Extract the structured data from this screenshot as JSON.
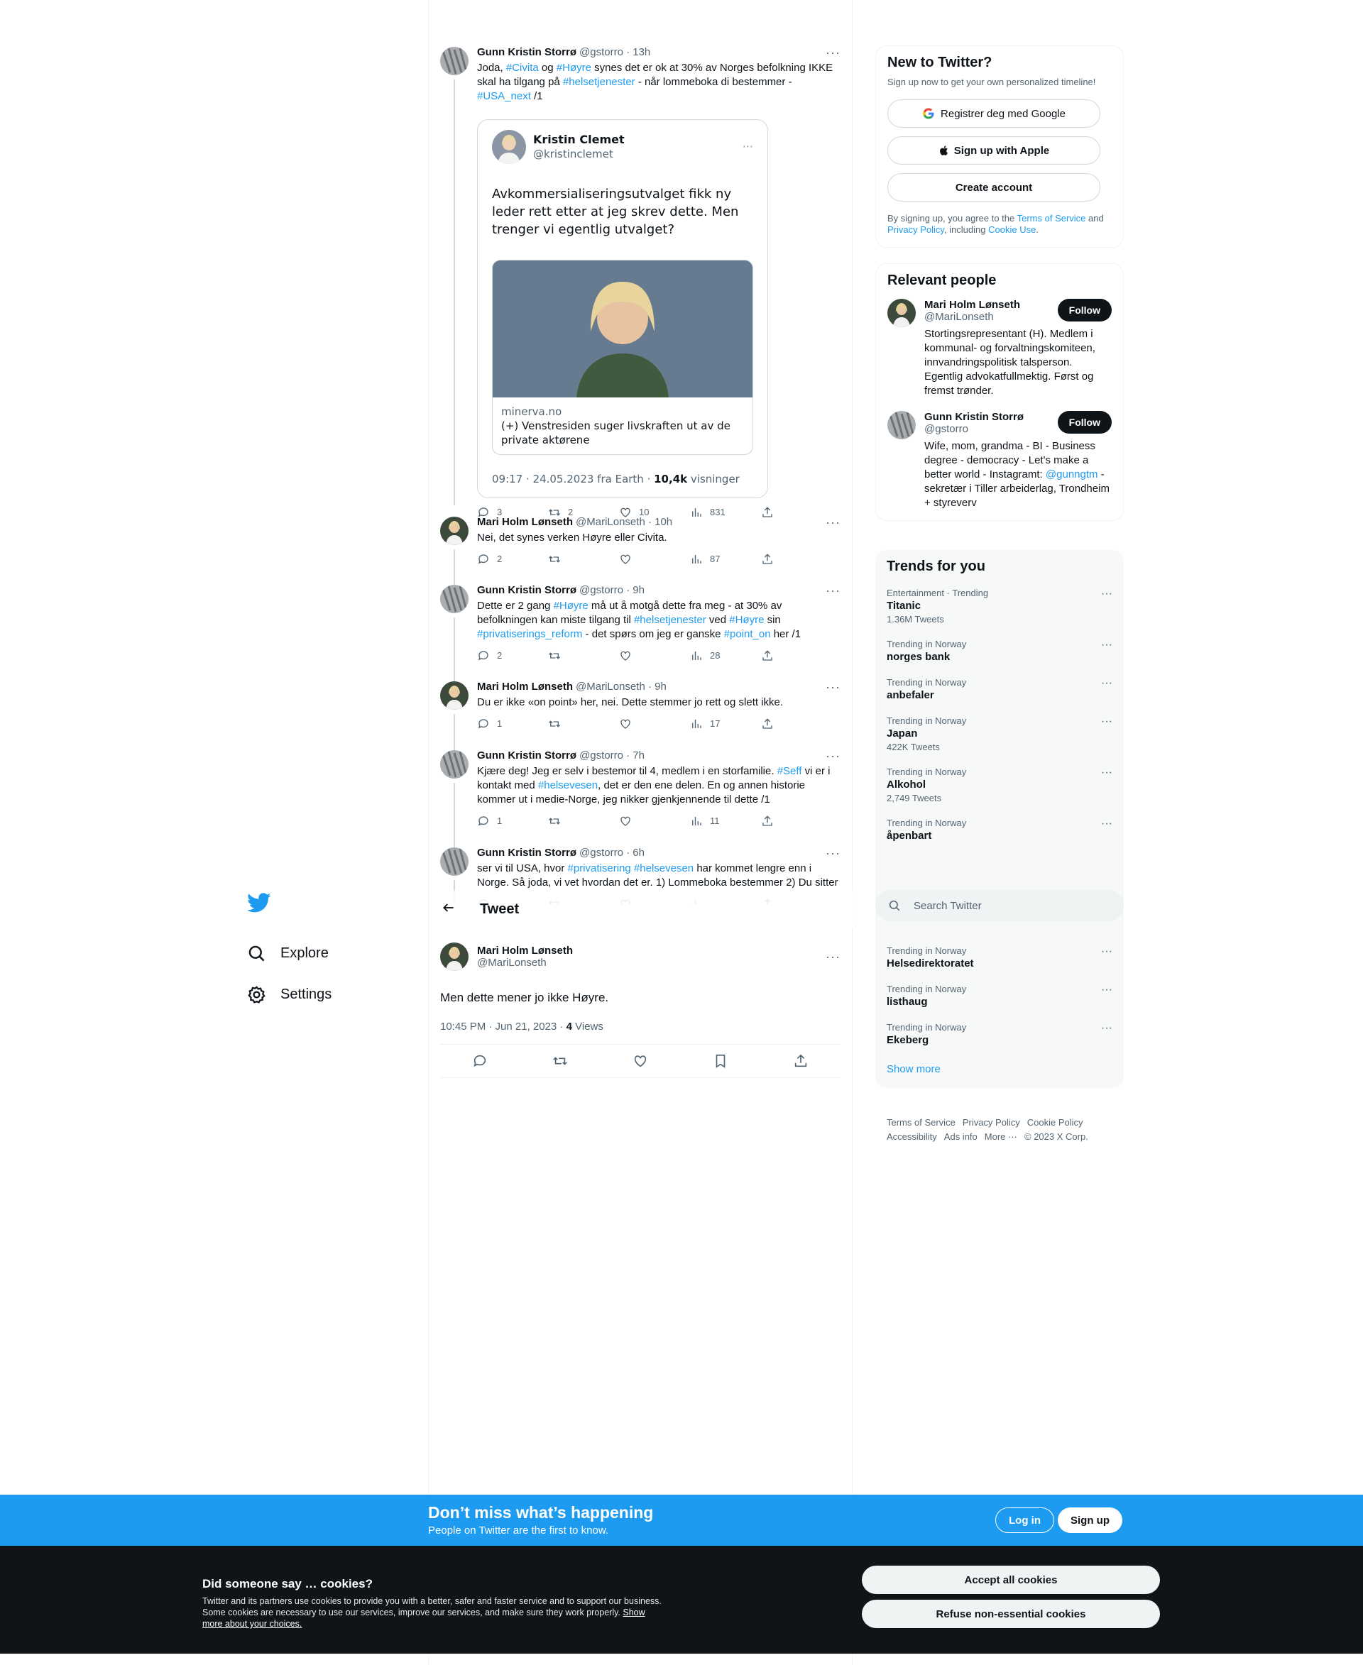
{
  "nav": {
    "explore": "Explore",
    "settings": "Settings"
  },
  "tweets": [
    {
      "name": "Gunn Kristin Storrø",
      "meta": "@gstorro · 13h",
      "parts": [
        [
          "Joda, ",
          ""
        ],
        [
          "#Civita",
          "b"
        ],
        [
          " og ",
          ""
        ],
        [
          "#Høyre",
          "b"
        ],
        [
          " synes det er  ok at 30% av Norges befolkning IKKE skal ha tilgang på ",
          ""
        ],
        [
          "#helsetjenester",
          "b"
        ],
        [
          " - når lommeboka di bestemmer - ",
          ""
        ],
        [
          "#USA_next",
          "b"
        ],
        [
          " /1",
          ""
        ]
      ],
      "replies": "3",
      "retweets": "2",
      "likes": "10",
      "views": "831"
    },
    {
      "name": "Mari Holm Lønseth",
      "meta": "@MariLonseth · 10h",
      "parts": [
        [
          "Nei, det synes verken Høyre eller Civita.",
          ""
        ]
      ],
      "replies": "2",
      "retweets": "",
      "likes": "",
      "views": "87"
    },
    {
      "name": "Gunn Kristin Storrø",
      "meta": "@gstorro · 9h",
      "parts": [
        [
          "Dette er 2 gang ",
          ""
        ],
        [
          "#Høyre",
          "b"
        ],
        [
          " må ut å motgå dette fra meg - at 30% av befolkningen kan miste tilgang til ",
          ""
        ],
        [
          "#helsetjenester",
          "b"
        ],
        [
          " ved ",
          ""
        ],
        [
          "#Høyre",
          "b"
        ],
        [
          " sin ",
          ""
        ],
        [
          "#privatiserings_reform",
          "b"
        ],
        [
          " - det spørs om jeg er ganske ",
          ""
        ],
        [
          "#point_on",
          "b"
        ],
        [
          " her /1",
          ""
        ]
      ],
      "replies": "2",
      "retweets": "",
      "likes": "",
      "views": "28"
    },
    {
      "name": "Mari Holm Lønseth",
      "meta": "@MariLonseth · 9h",
      "parts": [
        [
          "Du er ikke «on point» her, nei. Dette stemmer jo rett og slett ikke.",
          ""
        ]
      ],
      "replies": "1",
      "retweets": "",
      "likes": "",
      "views": "17"
    },
    {
      "name": "Gunn Kristin Storrø",
      "meta": "@gstorro · 7h",
      "parts": [
        [
          "Kjære deg! Jeg er selv i bestemor til 4, medlem i en storfamilie. ",
          ""
        ],
        [
          "#Seff",
          "b"
        ],
        [
          " vi er i kontakt med ",
          ""
        ],
        [
          "#helsevesen",
          "b"
        ],
        [
          ", det er den ene delen. En og annen historie kommer ut i medie-Norge, jeg nikker gjenkjennende til dette /1",
          ""
        ]
      ],
      "replies": "1",
      "retweets": "",
      "likes": "",
      "views": "11"
    },
    {
      "name": "Gunn Kristin Storrø",
      "meta": "@gstorro · 6h",
      "parts": [
        [
          "ser vi til USA, hvor ",
          ""
        ],
        [
          "#privatisering",
          "b"
        ],
        [
          " ",
          ""
        ],
        [
          "#helsevesen",
          "b"
        ],
        [
          " har kommet lengre enn i Norge. Så joda, vi vet hvordan det er. 1) Lommeboka bestemmer 2) Du sitter",
          ""
        ]
      ],
      "replies": "",
      "retweets": "",
      "likes": "",
      "views": ""
    }
  ],
  "quote": {
    "name": "Kristin Clemet",
    "handle": "@kristinclemet",
    "text": "Avkommersialiseringsutvalget fikk ny leder rett etter at jeg skrev dette. Men trenger vi egentlig utvalget?",
    "domain": "minerva.no",
    "card_title": "(+) Venstresiden suger livskraften ut av de private aktørene",
    "foot": "09:17 · 24.05.2023 fra Earth · ",
    "views_num": "10,4k",
    "views_label": " visninger"
  },
  "header": {
    "title": "Tweet"
  },
  "focus": {
    "name": "Mari Holm Lønseth",
    "handle": "@MariLonseth",
    "text": "Men dette mener jo ikke Høyre.",
    "meta": "10:45 PM · Jun 21, 2023 · ",
    "views": "4",
    "views_label": " Views"
  },
  "signup": {
    "title": "New to Twitter?",
    "subtitle": "Sign up now to get your own personalized timeline!",
    "google": "Registrer deg med Google",
    "apple": "Sign up with Apple",
    "create": "Create account",
    "legal_1": "By signing up, you agree to the ",
    "terms": "Terms of Service",
    "legal_2": " and ",
    "privacy": "Privacy Policy",
    "legal_3": ", including ",
    "cookie": "Cookie Use",
    "legal_4": "."
  },
  "relevant": {
    "title": "Relevant people",
    "people": [
      {
        "name": "Mari Holm Lønseth",
        "handle": "@MariLonseth",
        "follow": "Follow",
        "bio": "Stortingsrepresentant (H). Medlem i kommunal- og forvaltningskomiteen, innvandringspolitisk talsperson. Egentlig advokatfullmektig. Først og fremst trønder."
      },
      {
        "name": "Gunn Kristin Storrø",
        "handle": "@gstorro",
        "follow": "Follow",
        "bio_1": "Wife, mom, grandma - BI - Business degree - democracy - Let's make a better world - Instagramt: ",
        "bio_link": "@gunngtm",
        "bio_2": " - sekretær i Tiller arbeiderlag, Trondheim + styreverv"
      }
    ]
  },
  "trends": {
    "title": "Trends for you",
    "items": [
      {
        "meta": "Entertainment · Trending",
        "name": "Titanic",
        "count": "1.36M Tweets"
      },
      {
        "meta": "Trending in Norway",
        "name": "norges bank",
        "count": ""
      },
      {
        "meta": "Trending in Norway",
        "name": "anbefaler",
        "count": ""
      },
      {
        "meta": "Trending in Norway",
        "name": "Japan",
        "count": "422K Tweets"
      },
      {
        "meta": "Trending in Norway",
        "name": "Alkohol",
        "count": "2,749 Tweets"
      },
      {
        "meta": "Trending in Norway",
        "name": "åpenbart",
        "count": ""
      },
      {
        "meta": "Trending in Norway",
        "name": "Helsedirektoratet",
        "count": ""
      },
      {
        "meta": "Trending in Norway",
        "name": "listhaug",
        "count": ""
      },
      {
        "meta": "Trending in Norway",
        "name": "Ekeberg",
        "count": ""
      }
    ],
    "show_more": "Show more"
  },
  "search": {
    "placeholder": "Search Twitter"
  },
  "footer": {
    "terms": "Terms of Service",
    "privacy": "Privacy Policy",
    "cookie": "Cookie Policy",
    "accessibility": "Accessibility",
    "ads": "Ads info",
    "more": "More ···",
    "copy": "© 2023 X Corp."
  },
  "banner": {
    "title": "Don’t miss what’s happening",
    "subtitle": "People on Twitter are the first to know.",
    "login": "Log in",
    "signup": "Sign up"
  },
  "cookies": {
    "title": "Did someone say … cookies?",
    "desc": "Twitter and its partners use cookies to provide you with a better, safer and faster service and to support our business. Some cookies are necessary to use our services, improve our services, and make sure they work properly. ",
    "link": "Show more about your choices.",
    "accept": "Accept all cookies",
    "refuse": "Refuse non-essential cookies"
  },
  "colors": {
    "accent": "#1d9bf0",
    "text": "#0f1419",
    "muted": "#536471",
    "cookie_bg": "#0f1419"
  }
}
